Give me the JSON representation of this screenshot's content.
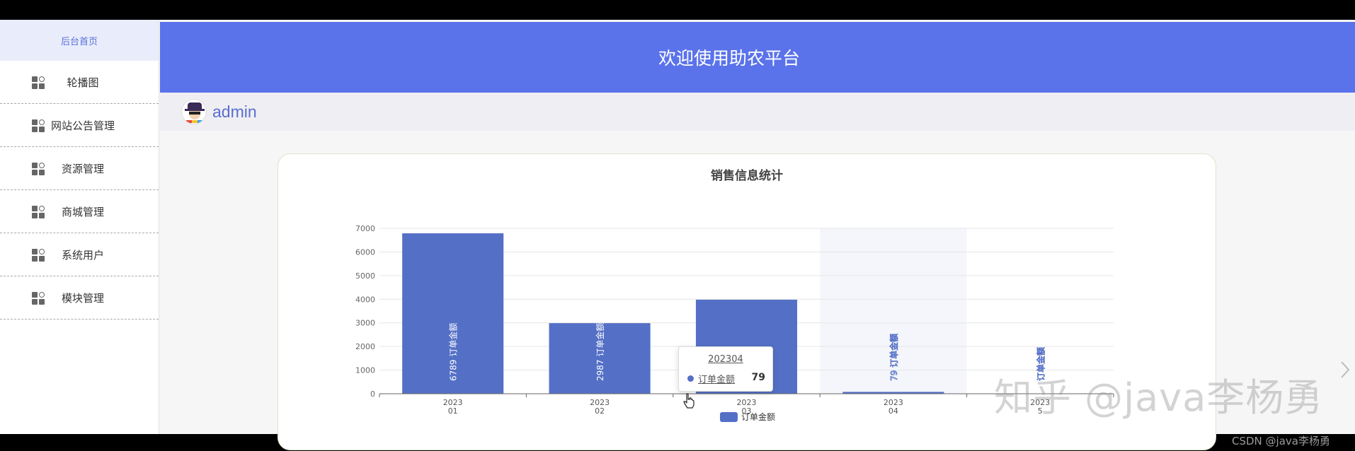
{
  "sidebar": {
    "home_label": "后台首页",
    "items": [
      {
        "label": "轮播图",
        "icon": "grid-icon"
      },
      {
        "label": "网站公告管理",
        "icon": "grid-icon"
      },
      {
        "label": "资源管理",
        "icon": "grid-icon"
      },
      {
        "label": "商城管理",
        "icon": "grid-icon"
      },
      {
        "label": "系统用户",
        "icon": "grid-icon"
      },
      {
        "label": "模块管理",
        "icon": "grid-icon"
      }
    ]
  },
  "header": {
    "title": "欢迎使用助农平台"
  },
  "user": {
    "name": "admin"
  },
  "tooltip": {
    "category": "202304",
    "series": "订单金额",
    "value": "79"
  },
  "watermarks": {
    "zhihu": "知乎 @java李杨勇",
    "csdn": "CSDN @java李杨勇"
  },
  "colors": {
    "header": "#5a72ea",
    "bar": "#5470c6",
    "sidebar_active": "#e9edfb"
  },
  "chart_data": {
    "type": "bar",
    "title": "销售信息统计",
    "categories": [
      "2023\n01",
      "2023\n02",
      "2023\n03",
      "2023\n04",
      "2023\n5"
    ],
    "series": [
      {
        "name": "订单金额",
        "values": [
          6789,
          2987,
          3980,
          79,
          0
        ]
      }
    ],
    "bar_labels": [
      "6789 订单金额",
      "2987 订单金额",
      "订单金额",
      "79 订单金额",
      "订单金额"
    ],
    "ylim": [
      0,
      7000
    ],
    "yticks": [
      0,
      1000,
      2000,
      3000,
      4000,
      5000,
      6000,
      7000
    ],
    "highlighted_index": 3,
    "legend": "bottom",
    "grid": true
  }
}
